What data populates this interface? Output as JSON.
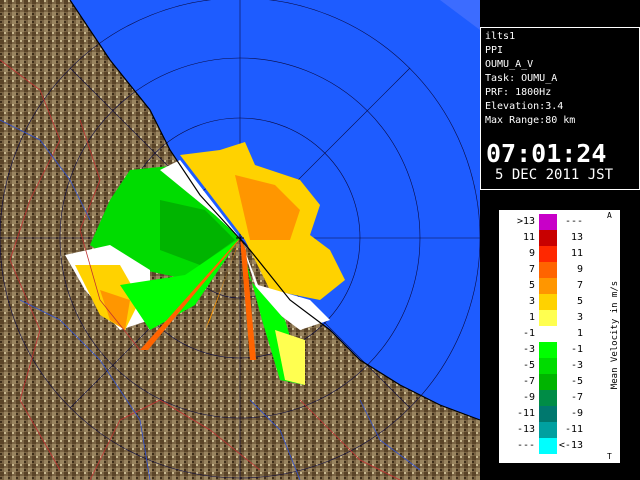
{
  "info": {
    "lines": [
      "ilts1",
      "PPI",
      "OUMU_A_V",
      "Task: OUMU_A",
      "PRF: 1800Hz",
      "Elevation:3.4",
      "Max Range:80 km"
    ],
    "time": "07:01:24",
    "date": "5 DEC 2011 JST"
  },
  "legend": {
    "title": "Mean Velocity in m/s",
    "corner_top": "A",
    "corner_bottom": "T",
    "rows": [
      {
        "left": ">13",
        "right": "---",
        "color": "#c800c8"
      },
      {
        "left": "11",
        "right": "13",
        "color": "#c80000"
      },
      {
        "left": "9",
        "right": "11",
        "color": "#ff2800"
      },
      {
        "left": "7",
        "right": "9",
        "color": "#ff6400"
      },
      {
        "left": "5",
        "right": "7",
        "color": "#ff9600"
      },
      {
        "left": "3",
        "right": "5",
        "color": "#ffd200"
      },
      {
        "left": "1",
        "right": "3",
        "color": "#ffff50"
      },
      {
        "left": "-1",
        "right": "1",
        "color": "#ffffff"
      },
      {
        "left": "-3",
        "right": "-1",
        "color": "#00ff00"
      },
      {
        "left": "-5",
        "right": "-3",
        "color": "#00dc00"
      },
      {
        "left": "-7",
        "right": "-5",
        "color": "#00b400"
      },
      {
        "left": "-9",
        "right": "-7",
        "color": "#008c46"
      },
      {
        "left": "-11",
        "right": "-9",
        "color": "#00786e"
      },
      {
        "left": "-13",
        "right": "-11",
        "color": "#00a0a0"
      },
      {
        "left": "---",
        "right": "<-13",
        "color": "#00ffff"
      }
    ]
  },
  "colors": {
    "sea": "#1e5cff",
    "sea_outer": "#3c6cff",
    "land": "#6e5a3a"
  }
}
